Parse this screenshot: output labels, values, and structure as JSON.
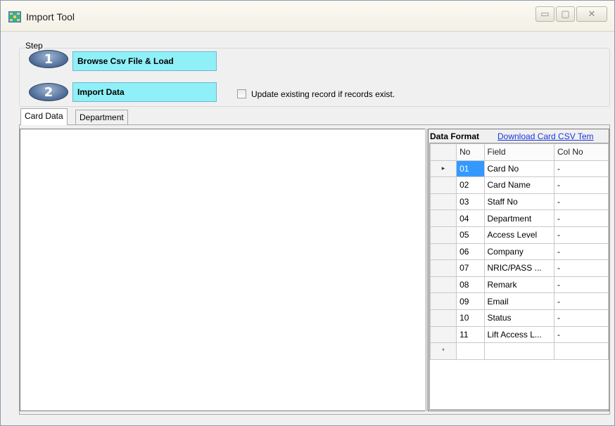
{
  "window": {
    "title": "Import Tool",
    "controls": {
      "minimize": "▭",
      "maximize": "▢",
      "close": "✕"
    }
  },
  "step_group": {
    "label": "Step",
    "step1": {
      "number": "1",
      "button_label": "Browse Csv File & Load"
    },
    "step2": {
      "number": "2",
      "button_label": "Import Data"
    },
    "update_checkbox": {
      "label": "Update existing record if records exist.",
      "checked": false
    }
  },
  "tabs": [
    {
      "label": "Card Data",
      "active": true
    },
    {
      "label": "Department",
      "active": false
    }
  ],
  "data_format": {
    "title": "Data Format",
    "download_link": "Download Card CSV Tem",
    "columns": [
      "No",
      "Field",
      "Col No"
    ],
    "rows": [
      {
        "no": "01",
        "field": "Card No",
        "col": "-"
      },
      {
        "no": "02",
        "field": "Card Name",
        "col": "-"
      },
      {
        "no": "03",
        "field": "Staff No",
        "col": "-"
      },
      {
        "no": "04",
        "field": "Department",
        "col": "-"
      },
      {
        "no": "05",
        "field": "Access Level",
        "col": "-"
      },
      {
        "no": "06",
        "field": "Company",
        "col": "-"
      },
      {
        "no": "07",
        "field": "NRIC/PASS ...",
        "col": "-"
      },
      {
        "no": "08",
        "field": "Remark",
        "col": "-"
      },
      {
        "no": "09",
        "field": "Email",
        "col": "-"
      },
      {
        "no": "10",
        "field": "Status",
        "col": "-"
      },
      {
        "no": "11",
        "field": "Lift Access L...",
        "col": "-"
      }
    ],
    "current_row_marker": "▸",
    "new_row_marker": "*"
  },
  "colors": {
    "step_button_bg": "#8ff0f8",
    "selected_cell": "#3399ff",
    "link": "#1a35e0"
  }
}
